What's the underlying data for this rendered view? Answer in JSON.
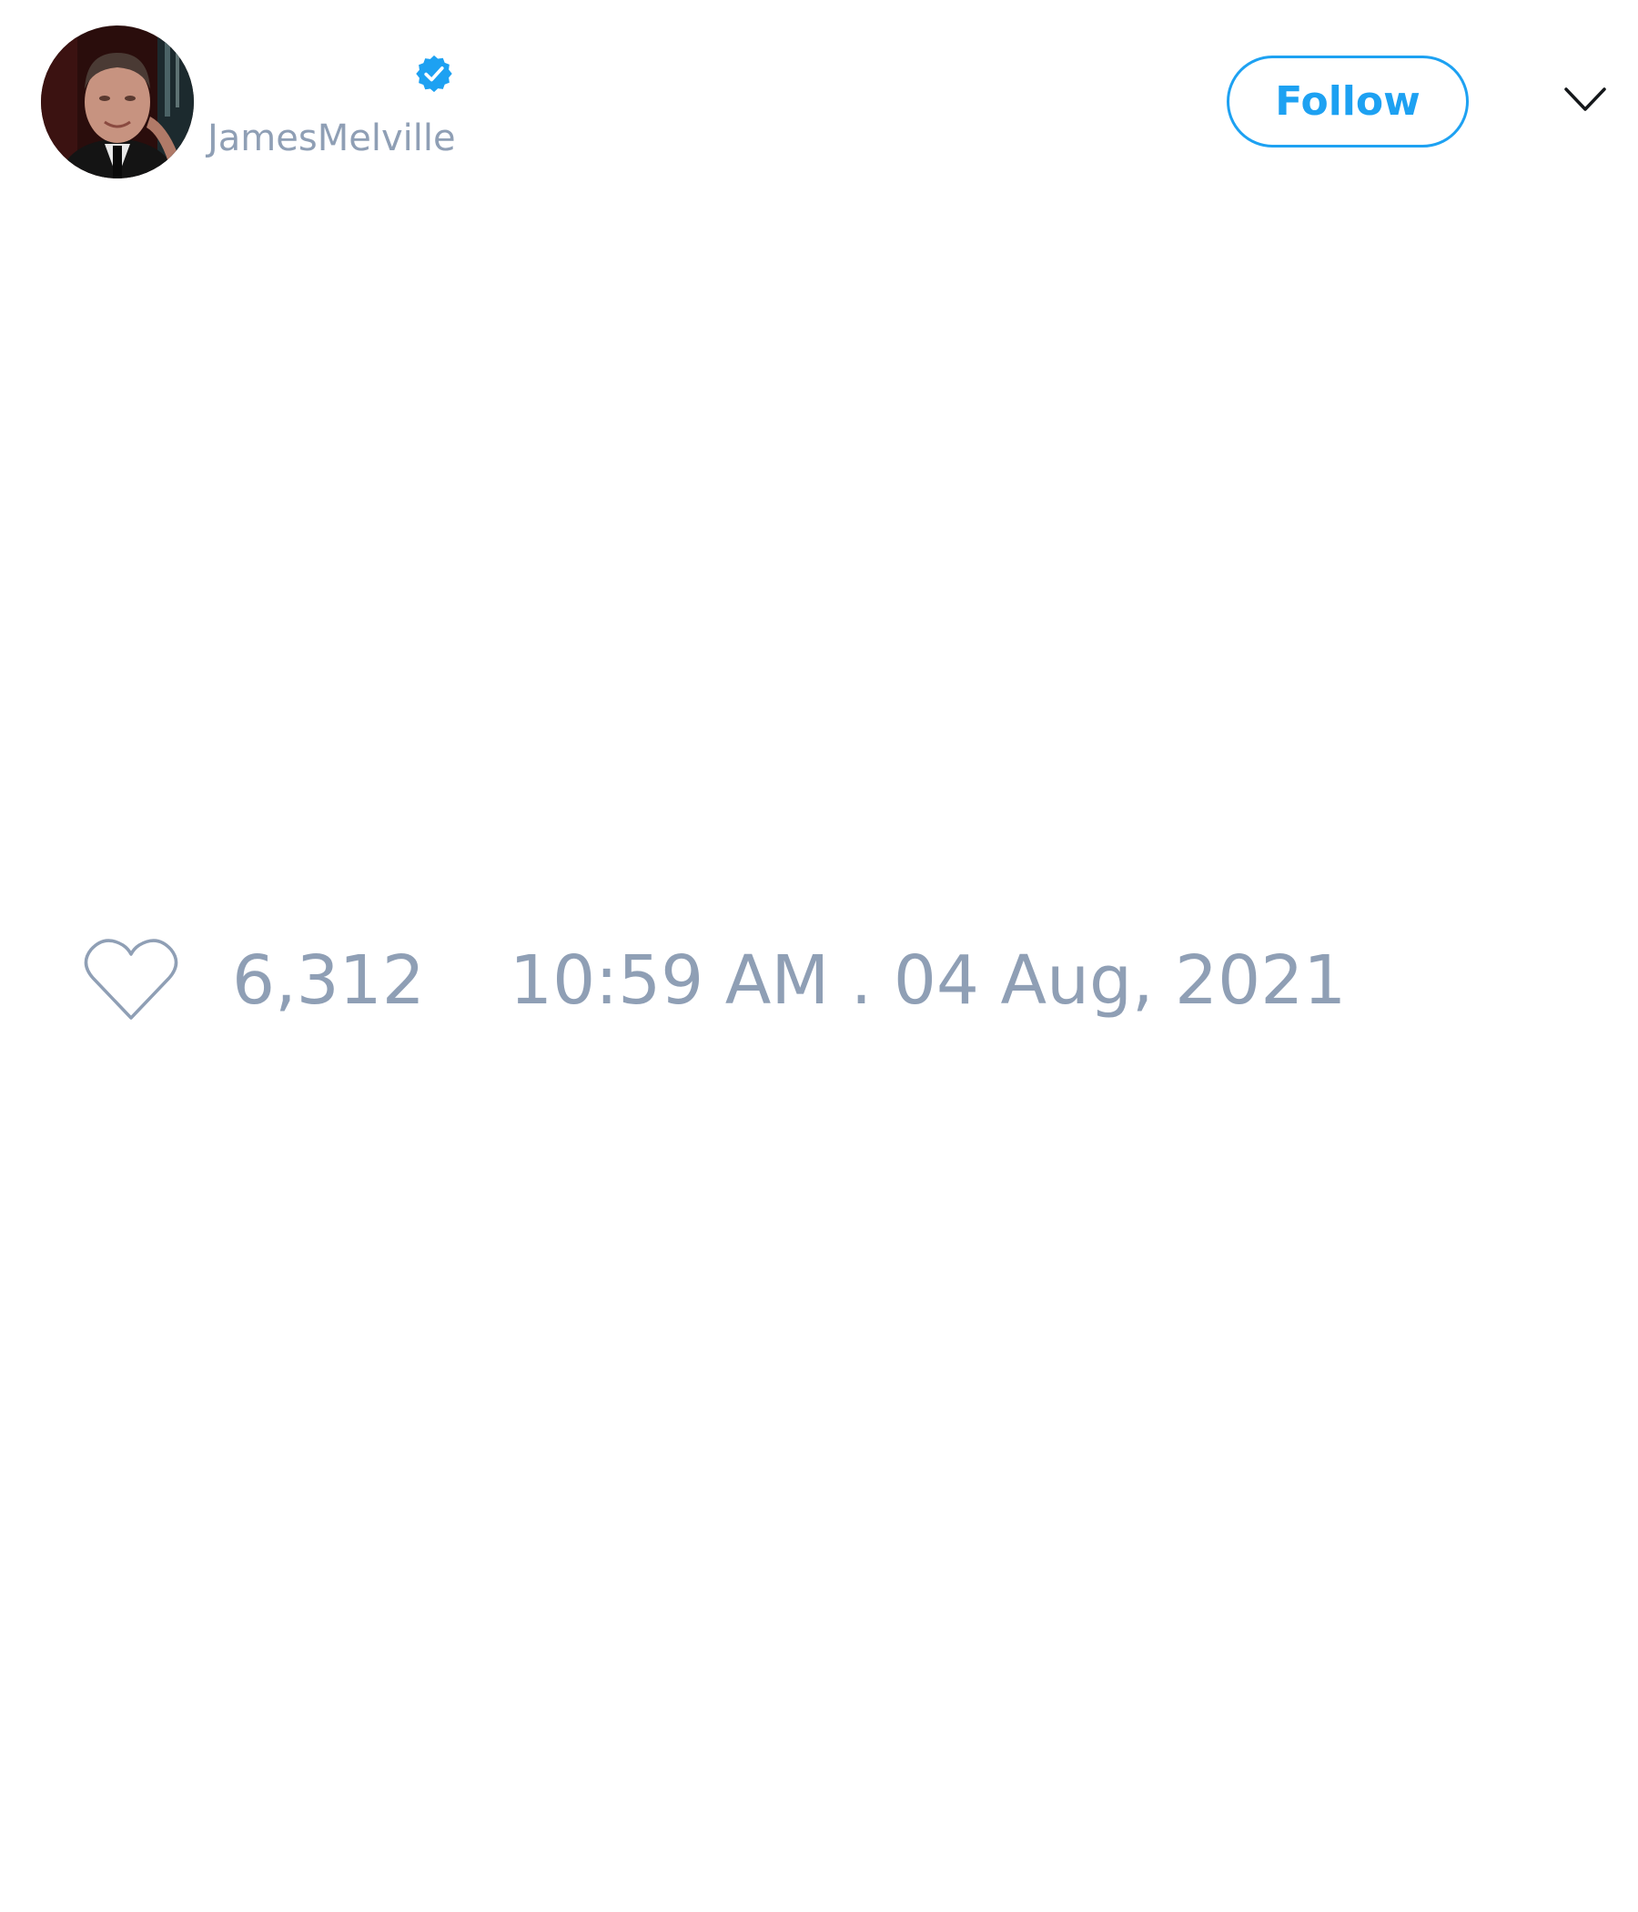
{
  "tweet": {
    "author": {
      "display_name": "",
      "handle": "JamesMelville",
      "verified": true,
      "avatar": "profile-photo"
    },
    "follow_label": "Follow",
    "menu_icon": "chevron-down-icon",
    "like_icon": "heart-outline-icon",
    "like_count": "6,312",
    "timestamp": "10:59 AM . 04 Aug, 2021"
  },
  "colors": {
    "accent": "#1da1f2",
    "muted_text": "#8f9fb5",
    "background": "#ffffff"
  }
}
